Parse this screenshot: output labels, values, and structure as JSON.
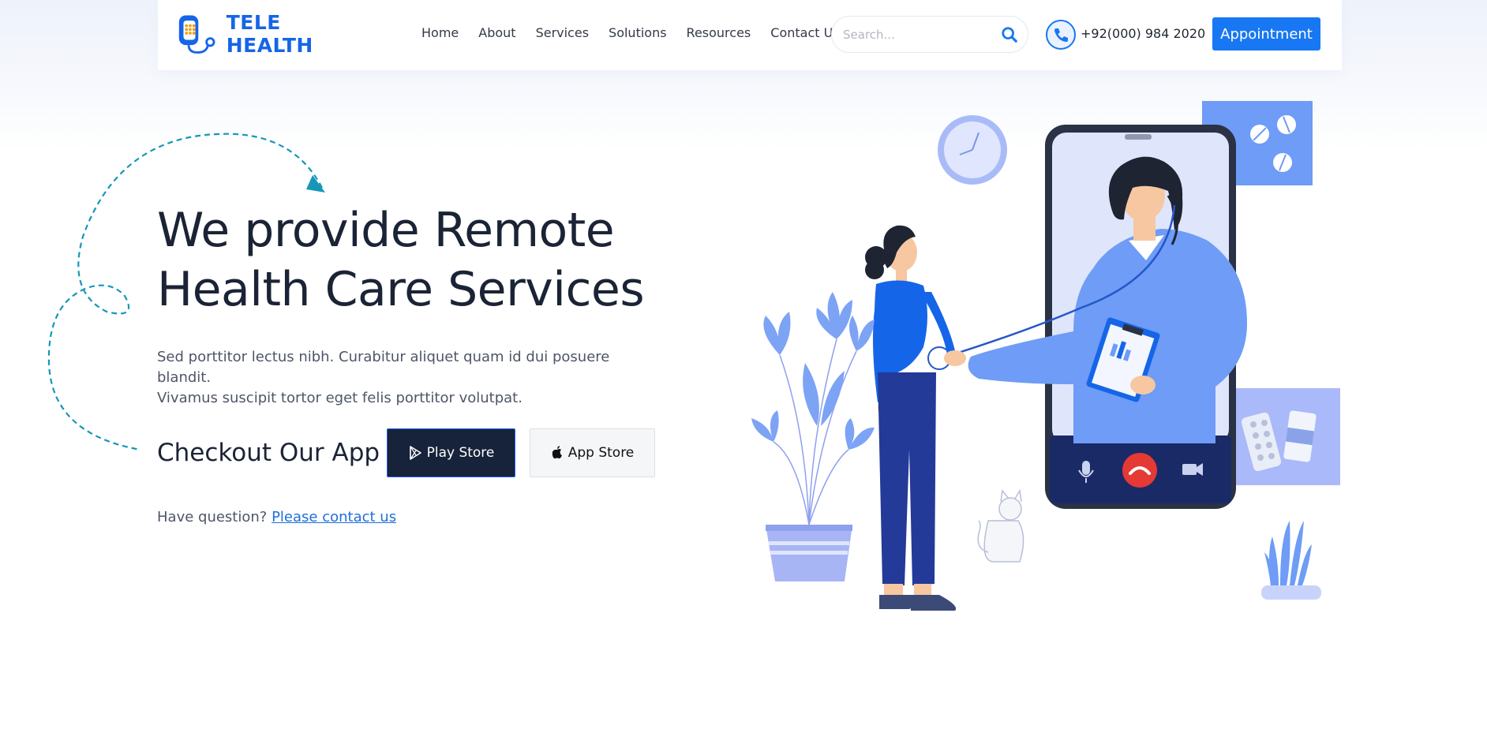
{
  "brand": {
    "name": "TELE HEALTH",
    "colors": {
      "primary": "#1877f2",
      "dark": "#17233a",
      "accent": "#1e6fd9",
      "illustration_blue": "#6e9cf6"
    }
  },
  "nav": {
    "items": [
      {
        "label": "Home"
      },
      {
        "label": "About"
      },
      {
        "label": "Services"
      },
      {
        "label": "Solutions"
      },
      {
        "label": "Resources"
      },
      {
        "label": "Contact Us"
      }
    ]
  },
  "search": {
    "placeholder": "Search...",
    "value": "",
    "icon": "search-icon"
  },
  "contact": {
    "phone": "+92(000) 984 2020",
    "icon": "phone-icon"
  },
  "header": {
    "appointment_label": "Appointment"
  },
  "hero": {
    "title_line1": "We provide Remote",
    "title_line2": "Health Care Services",
    "desc_line1": "Sed porttitor lectus nibh. Curabitur aliquet quam id dui posuere blandit.",
    "desc_line2": "Vivamus suscipit tortor eget felis porttitor volutpat.",
    "checkout_label": "Checkout Our App",
    "play_store_label": "Play Store",
    "app_store_label": "App Store",
    "question_text": "Have question?",
    "contact_link": "Please contact us"
  }
}
